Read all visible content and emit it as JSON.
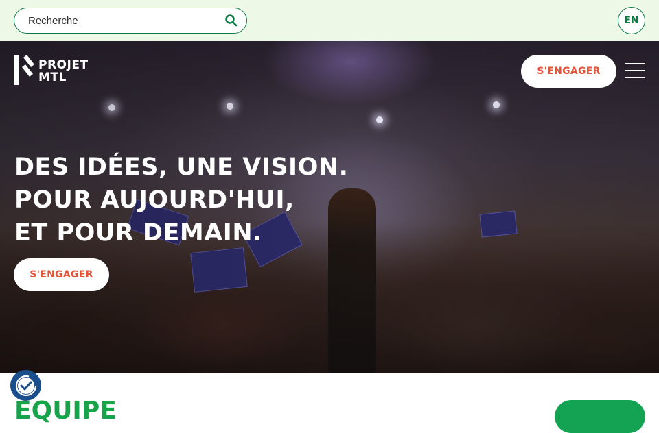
{
  "topbar": {
    "search": {
      "placeholder": "Recherche",
      "value": "",
      "icon": "search-icon"
    },
    "language_button": "EN"
  },
  "header": {
    "logo_text": [
      "PROJET",
      "MTL"
    ],
    "engage_label": "S'ENGAGER",
    "menu_icon": "hamburger-menu-icon"
  },
  "hero": {
    "headline": [
      "DES IDÉES, UNE VISION.",
      "POUR AUJOURD'HUI,",
      "ET POUR DEMAIN."
    ],
    "cta_label": "S'ENGAGER"
  },
  "section": {
    "title": "ÉQUIPE"
  },
  "consent_widget": {
    "icon": "cookie-consent-icon"
  },
  "colors": {
    "brand_green": "#0a7a43",
    "accent_orange": "#e2553b",
    "section_green": "#16a34a",
    "topbar_bg": "#eef8e7"
  }
}
